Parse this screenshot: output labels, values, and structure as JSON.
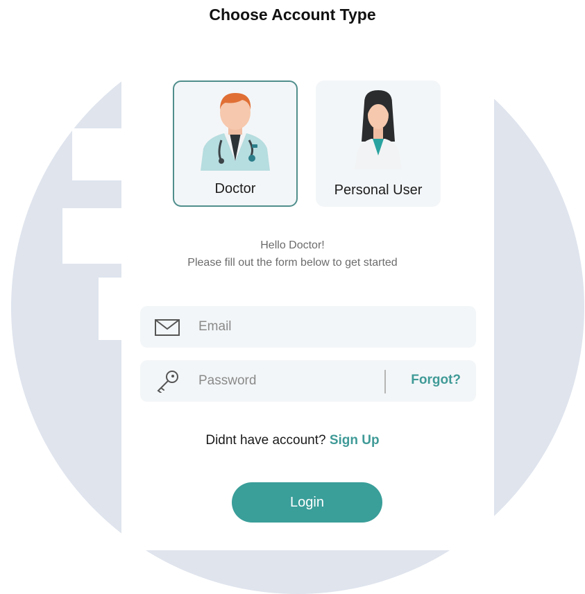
{
  "title": "Choose Account Type",
  "account_types": [
    {
      "label": "Doctor",
      "selected": true,
      "icon": "doctor-avatar-icon"
    },
    {
      "label": "Personal User",
      "selected": false,
      "icon": "personal-user-avatar-icon"
    }
  ],
  "greeting": {
    "line1": "Hello Doctor!",
    "line2": "Please fill out the form below to get started"
  },
  "form": {
    "email_placeholder": "Email",
    "email_icon": "envelope-icon",
    "password_placeholder": "Password",
    "password_icon": "key-icon",
    "forgot_label": "Forgot?"
  },
  "signup": {
    "prompt": "Didnt have account?",
    "link_label": "Sign Up"
  },
  "login_label": "Login",
  "colors": {
    "accent": "#3a9e99",
    "selected_border": "#4f8e8c",
    "field_bg": "#f3f6f8",
    "background_circle": "#dfe4ed"
  }
}
